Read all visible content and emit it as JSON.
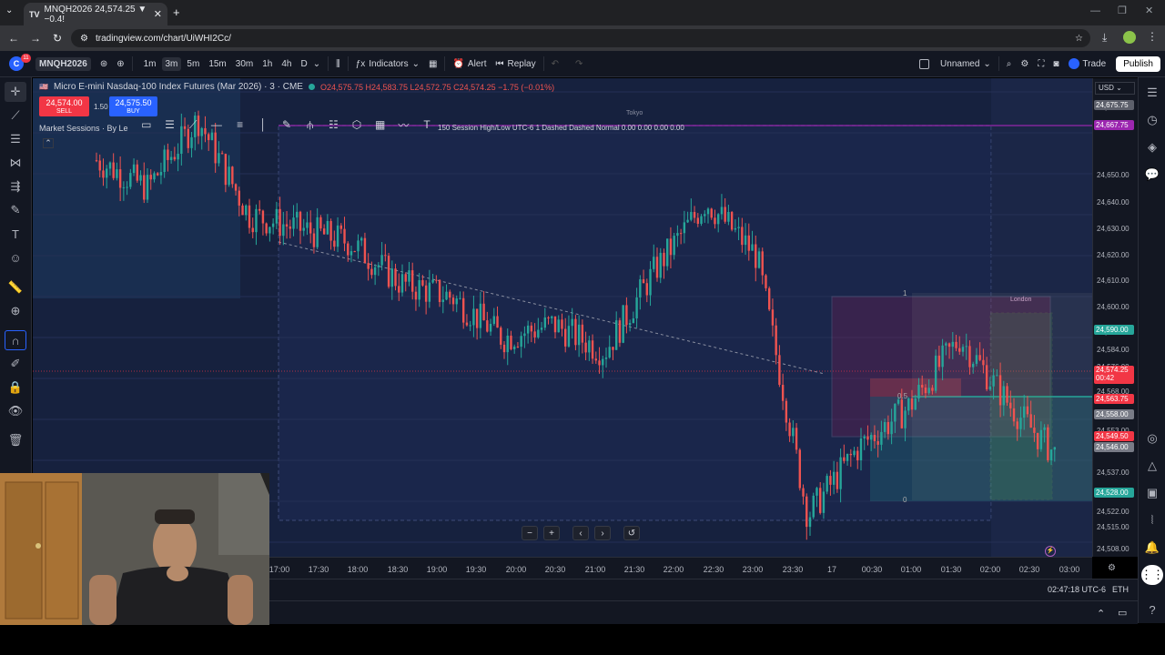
{
  "browser": {
    "tab_title": "MNQH2026 24,574.25 ▼ −0.4!",
    "url": "tradingview.com/chart/UiWHI2Cc/"
  },
  "toolbar": {
    "symbol": "MNQH2026",
    "intervals": [
      "1m",
      "3m",
      "5m",
      "15m",
      "30m",
      "1h",
      "4h",
      "D"
    ],
    "active_interval": "3m",
    "indicators": "Indicators",
    "alert": "Alert",
    "replay": "Replay",
    "layout_name": "Unnamed",
    "trade": "Trade",
    "publish": "Publish",
    "avatar_badge": "11"
  },
  "legend": {
    "title": "Micro E-mini Nasdaq-100 Index Futures (Mar 2026) · 3 · CME",
    "ohlc": "O24,575.75 H24,583.75 L24,572.75 C24,574.25 −1.75 (−0.01%)",
    "sell_price": "24,574.00",
    "sell_label": "SELL",
    "spread": "1.50",
    "buy_price": "24,575.50",
    "buy_label": "BUY",
    "indicator_row": "Market Sessions · By Le",
    "session_text": "150 Session High/Low UTC-6 1 Dashed Dashed Normal  0.00  0.00  0.00  0.00",
    "tokyo_label": "Tokyo",
    "london_label": "London"
  },
  "fib": {
    "level_1": "1",
    "level_05": "0.5",
    "level_0": "0"
  },
  "price_axis": {
    "currency": "USD",
    "labels": [
      "24,670.00",
      "24,660.00",
      "24,650.00",
      "24,640.00",
      "24,630.00",
      "24,620.00",
      "24,610.00",
      "24,600.00",
      "24,592.00",
      "24,584.00",
      "24,576.00",
      "24,568.00",
      "24,553.00",
      "24,537.00",
      "24,522.00",
      "24,515.00",
      "24,508.00"
    ],
    "tags": {
      "p1": "24,675.75",
      "p2": "24,667.75",
      "p3": "24,590.00",
      "p4": "24,574.25",
      "p4b": "00:42",
      "p5": "24,563.75",
      "p6": "24,558.00",
      "p7": "24,549.50",
      "p8": "24,546.00",
      "p9": "24,528.00"
    }
  },
  "time_axis": [
    "17:00",
    "17:30",
    "18:00",
    "18:30",
    "19:00",
    "19:30",
    "20:00",
    "20:30",
    "21:00",
    "21:30",
    "22:00",
    "22:30",
    "23:00",
    "23:30",
    "17",
    "00:30",
    "01:00",
    "01:30",
    "02:00",
    "02:30",
    "03:00"
  ],
  "status": {
    "clock": "02:47:18 UTC-6",
    "session": "ETH"
  },
  "colors": {
    "up": "#26a69a",
    "down": "#ef5350",
    "bg": "#131722",
    "accent": "#2962ff"
  },
  "chart_data": {
    "type": "candlestick",
    "title": "Micro E-mini Nasdaq-100 Index Futures (Mar 2026) · 3 · CME",
    "x": [
      "17:00",
      "17:30",
      "18:00",
      "18:30",
      "19:00",
      "19:30",
      "20:00",
      "20:30",
      "21:00",
      "21:30",
      "22:00",
      "22:30",
      "23:00",
      "23:30",
      "17",
      "00:30",
      "01:00",
      "01:30",
      "02:00",
      "02:30",
      "03:00"
    ],
    "close_path": [
      24650,
      24640,
      24665,
      24630,
      24625,
      24620,
      24605,
      24600,
      24585,
      24590,
      24580,
      24610,
      24635,
      24615,
      24520,
      24545,
      24560,
      24585,
      24560,
      24540,
      24574
    ],
    "ylim": [
      24505,
      24680
    ],
    "last_close": 24574.25
  }
}
